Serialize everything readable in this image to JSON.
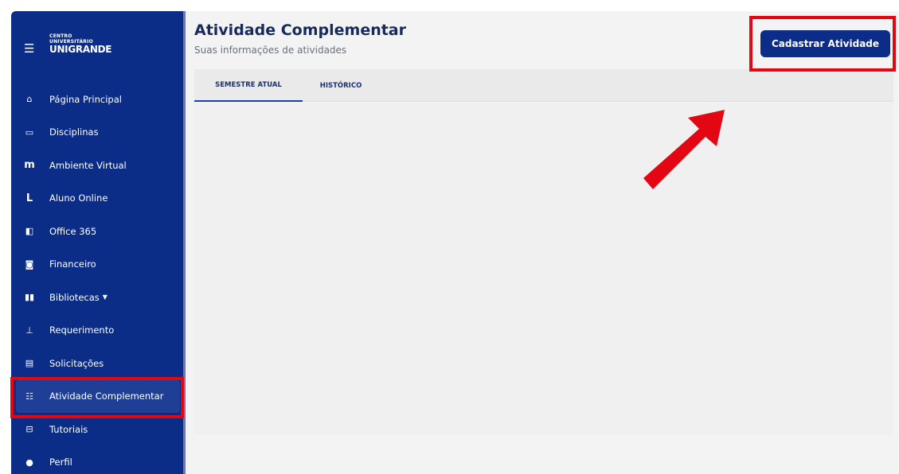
{
  "sidebar": {
    "logo_line1": "CENTRO",
    "logo_line2": "UNIVERSITÁRIO",
    "logo_line3": "UNIGRANDE",
    "items": [
      {
        "label": "Página Principal",
        "icon": "home-icon"
      },
      {
        "label": "Disciplinas",
        "icon": "book-icon"
      },
      {
        "label": "Ambiente Virtual",
        "icon": "moodle-icon"
      },
      {
        "label": "Aluno Online",
        "icon": "l-icon"
      },
      {
        "label": "Office 365",
        "icon": "office-icon"
      },
      {
        "label": "Financeiro",
        "icon": "money-icon"
      },
      {
        "label": "Bibliotecas",
        "icon": "library-icon"
      },
      {
        "label": "Requerimento",
        "icon": "pin-icon"
      },
      {
        "label": "Solicitações",
        "icon": "file-icon"
      },
      {
        "label": "Atividade Complementar",
        "icon": "list-icon"
      },
      {
        "label": "Tutoriais",
        "icon": "tutorial-icon"
      },
      {
        "label": "Perfil",
        "icon": "user-icon"
      }
    ]
  },
  "header": {
    "title": "Atividade Complementar",
    "subtitle": "Suas informações de atividades",
    "cta_label": "Cadastrar Atividade"
  },
  "tabs": [
    {
      "label": "SEMESTRE ATUAL"
    },
    {
      "label": "HISTÓRICO"
    }
  ],
  "colors": {
    "sidebar": "#0b2d87",
    "accent": "#0b2d87",
    "highlight": "#e30613"
  }
}
